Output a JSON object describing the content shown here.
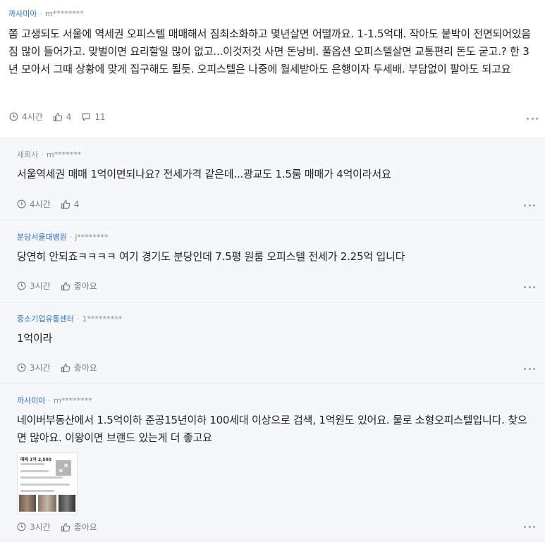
{
  "comments": [
    {
      "nickname": "까사미아",
      "user": "m********",
      "text": "쫌 고생되도 서울에 역세권 오피스텔 매매해서 짐최소화하고 몇년살면 어떨까요. 1-1.5억대. 작아도 붙박이 전면되어있음 짐 많이 들어가고. 맞벌이면 요리할일 많이 없고...이것저것 사면 돈낭비. 풀옵션 오피스텔살면 교통편리 돈도 굳고.? 한 3년 모아서 그때 상황에 맞게 집구해도 될듯. 오피스텔은 나중에 월세받아도 은행이자 두세배. 부담없이 팔아도 되고요",
      "time": "4시간",
      "likes": "4",
      "replies": "11"
    },
    {
      "nickname": "새회사",
      "user": "m*******",
      "text": "서울역세권 매매 1억이면되나요? 전세가격 같은데...광교도 1.5룸 매매가 4억이라서요",
      "time": "4시간",
      "likes": "4"
    },
    {
      "nickname": "분당서울대병원",
      "user": "j********",
      "text": "당연히 안되죠ㅋㅋㅋㅋ 여기 경기도 분당인데 7.5평 원룸 오피스텔 전세가 2.25억 입니다",
      "time": "3시간",
      "likes": "좋아요"
    },
    {
      "nickname": "중소기업유통센터",
      "user": "1*********",
      "text": "1억이라",
      "time": "3시간",
      "likes": "좋아요"
    },
    {
      "nickname": "까사미아",
      "user": "m********",
      "text": "네이버부동산에서 1.5억이하 준공15년이하 100세대 이상으로 검색, 1억원도 있어요. 물로 소형오피스텔입니다. 찾으면 많아요. 이왕이면 브랜드 있는게 더 좋고요",
      "time": "3시간",
      "likes": "좋아요",
      "attachment_title": "매매 1억 3,500"
    }
  ],
  "colors": {
    "accent": "#2b6fd6",
    "reply_bg": "#f6f7f9",
    "meta_gray": "#7b8087"
  },
  "icons": {
    "time": "clock-icon",
    "like": "thumbs-up-icon",
    "reply": "speech-bubble-icon",
    "more": "more-dots-icon",
    "expand": "expand-icon"
  }
}
